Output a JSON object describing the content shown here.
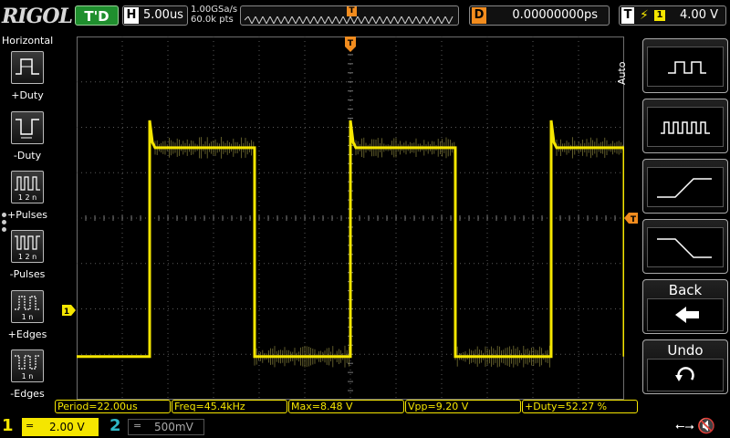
{
  "brand": {
    "logo": "RIGOL"
  },
  "status": {
    "trigger_state": "T'D"
  },
  "horizontal": {
    "tag": "H",
    "timebase": "5.00us"
  },
  "acquisition": {
    "sample_rate": "1.00GSa/s",
    "memory_depth": "60.0k pts"
  },
  "memory_strip": {
    "trigger_marker": "T"
  },
  "delay": {
    "tag": "D",
    "value": "0.00000000ps"
  },
  "trigger": {
    "tag": "T",
    "edge_symbol": "⚡",
    "source": "1",
    "level": "4.00 V"
  },
  "left_menu": {
    "title": "Horizontal",
    "items": [
      {
        "label": "+Duty",
        "icon": "pos-duty-icon",
        "icon_text": ""
      },
      {
        "label": "-Duty",
        "icon": "neg-duty-icon",
        "icon_text": ""
      },
      {
        "label": "+Pulses",
        "icon": "pos-pulses-icon",
        "icon_text": "1 2 n"
      },
      {
        "label": "-Pulses",
        "icon": "neg-pulses-icon",
        "icon_text": "1 2 n"
      },
      {
        "label": "+Edges",
        "icon": "pos-edges-icon",
        "icon_text": "1 n"
      },
      {
        "label": "-Edges",
        "icon": "neg-edges-icon",
        "icon_text": "1 n"
      }
    ]
  },
  "right_menu": {
    "auto_label": "Auto",
    "buttons": [
      {
        "name": "period-measure-button",
        "icon": "single-pulse-icon"
      },
      {
        "name": "multi-period-button",
        "icon": "pulse-train-icon"
      },
      {
        "name": "rise-time-button",
        "icon": "rising-edge-icon"
      },
      {
        "name": "fall-time-button",
        "icon": "falling-edge-icon"
      },
      {
        "name": "back-button",
        "label": "Back",
        "icon": "left-arrow-icon"
      },
      {
        "name": "undo-button",
        "label": "Undo",
        "icon": "undo-icon"
      }
    ]
  },
  "markers": {
    "trigger_top": "T",
    "trigger_level": "T",
    "ch1_ground": "1"
  },
  "measurements": [
    {
      "label": "Period=22.00us"
    },
    {
      "label": "Freq=45.4kHz"
    },
    {
      "label": "Max=8.48 V"
    },
    {
      "label": "Vpp=9.20 V"
    },
    {
      "label": "+Duty=52.27 %"
    }
  ],
  "channels": [
    {
      "number": "1",
      "coupling": "=",
      "scale": "2.00 V",
      "color": "#f5e600",
      "active": true
    },
    {
      "number": "2",
      "coupling": "=",
      "scale": "500mV",
      "color": "#2fb9c8",
      "active": false
    }
  ],
  "waveform": {
    "timebase_us_per_div": 5,
    "volts_per_div": 2,
    "duty_percent": 52.27,
    "period_us": 22.0,
    "high_v": 7.2,
    "low_v": -2.0,
    "trace_color": "#f5e600"
  },
  "status_icons": {
    "usb": "usb-icon",
    "sound": "speaker-muted-icon"
  }
}
